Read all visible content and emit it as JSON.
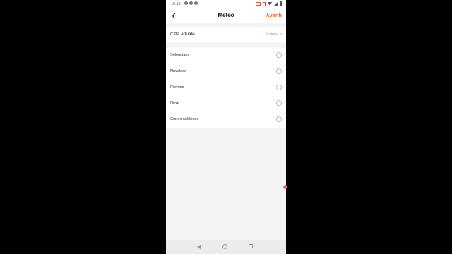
{
  "status_bar": {
    "time": "18.15"
  },
  "header": {
    "title": "Meteo",
    "next_label": "Avanti"
  },
  "city": {
    "label": "Città attuale",
    "value": "Matera"
  },
  "options": [
    {
      "label": "Soleggiato"
    },
    {
      "label": "Nuvoloso"
    },
    {
      "label": "Piovoso"
    },
    {
      "label": "Neve"
    },
    {
      "label": "Giorno nebbioso"
    }
  ],
  "colors": {
    "accent": "#e8652a",
    "background": "#f4f4f4"
  },
  "icons": {
    "back": "chevron-left-icon",
    "city_chevron": "chevron-right-icon",
    "radio": "radio-unchecked-icon",
    "nav": [
      "nav-back-icon",
      "nav-home-icon",
      "nav-recent-icon"
    ]
  }
}
